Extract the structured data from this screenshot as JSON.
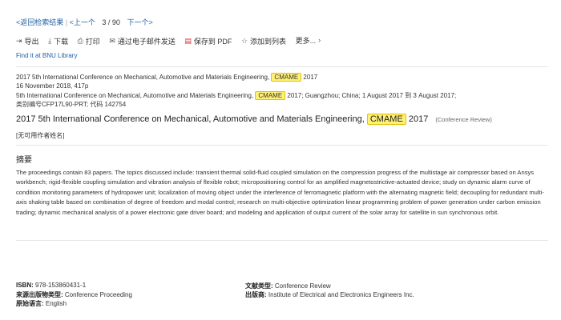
{
  "nav": {
    "back": "<返回检索结果",
    "prev": "<上一个",
    "position": "3 / 90",
    "next": "下一个>"
  },
  "toolbar": {
    "export": "导出",
    "download": "下载",
    "print": "打印",
    "email": "通过电子邮件发送",
    "pdf": "保存到 PDF",
    "addlist": "添加到列表",
    "more": "更多..."
  },
  "find_link": "Find it at BNU Library",
  "source": {
    "line1_pre": "2017 5th International Conference on Mechanical, Automotive and Materials Engineering, ",
    "line1_hl": "CMAME",
    "line1_post": " 2017",
    "line2": "16 November 2018, 417p",
    "line3_pre": "5th International Conference on Mechanical, Automotive and Materials Engineering, ",
    "line3_hl": "CMAME",
    "line3_post": " 2017; Guangzhou; China; 1 August 2017 到 3 August 2017;",
    "line4": "类别编号CFP17L90-PRT; 代码 142754"
  },
  "title": {
    "pre": "2017 5th International Conference on Mechanical, Automotive and Materials Engineering, ",
    "hl": "CMAME",
    "post": " 2017",
    "type": "(Conference Review)"
  },
  "author": "[无可用作者姓名]",
  "abstract_heading": "摘要",
  "abstract": "The proceedings contain 83 papers. The topics discussed include: transient thermal solid-fluid coupled simulation on the compression progress of the multistage air compressor based on Ansys workbench; rigid-flexible coupling simulation and vibration analysis of flexible robot; micropositioning control for an amplified magnetostrictive-actuated device; study on dynamic alarm curve of condition monitoring parameters of hydropower unit; localization of moving object under the interference of ferromagnetic platform with the alternating magnetic field; decoupling for redundant multi-axis shaking table based on combination of degree of freedom and modal control; research on multi-objective optimization linear programming problem of power generation under carbon emission trading; dynamic mechanical analysis of a power electronic gate driver board; and modeling and application of output current of the solar array for satellite in sun synchronous orbit.",
  "meta": {
    "isbn_label": "ISBN:",
    "isbn": " 978-153860431-1",
    "srctype_label": "来源出版物类型:",
    "srctype": " Conference Proceeding",
    "lang_label": "原始语言:",
    "lang": " English",
    "doctype_label": "文献类型:",
    "doctype": " Conference Review",
    "publisher_label": "出版商:",
    "publisher": " Institute of Electrical and Electronics Engineers Inc."
  }
}
